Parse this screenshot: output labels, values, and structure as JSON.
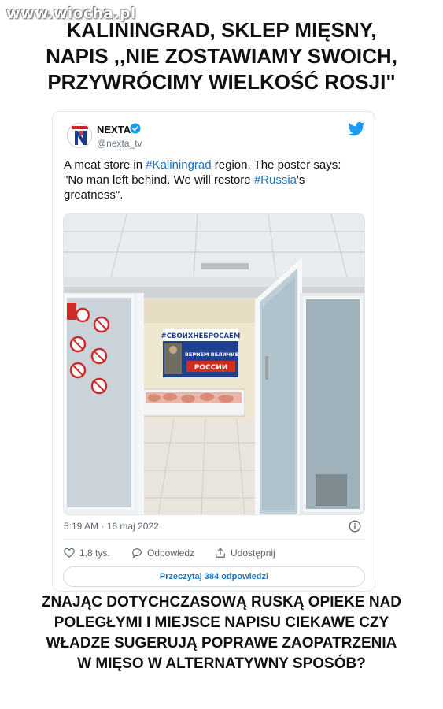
{
  "watermark": "www.wiocha.pl",
  "headline": [
    "KALININGRAD, SKLEP MIĘSNY,",
    "NAPIS ,,NIE ZOSTAWIAMY SWOICH,",
    "PRZYWRÓCIMY WIELKOŚĆ ROSJI\""
  ],
  "tweet": {
    "author_name": "NEXTA",
    "author_handle": "@nexta_tv",
    "text_parts": [
      "A meat store in ",
      "#Kaliningrad",
      " region. The poster says: \"No man left behind. We will restore ",
      "#Russia",
      "'s greatness\"."
    ],
    "timestamp": "5:19 AM · 16 maj 2022",
    "likes": "1,8 tys.",
    "reply_label": "Odpowiedz",
    "share_label": "Udostępnij",
    "read_replies": "Przeczytaj 384 odpowiedzi",
    "poster_text": {
      "hashtag": "#СВОИХНЕБРОСАЕМ",
      "line1": "ВЕРНЕМ ВЕЛИЧИЕ",
      "line2": "РОССИИ"
    }
  },
  "bottom_text": [
    "ZNAJĄC DOTYCHCZASOWĄ RUSKĄ  OPIEKE NAD",
    "POLEGŁYMI I MIEJSCE NAPISU CIEKAWE CZY",
    "WŁADZE SUGERUJĄ POPRAWE ZAOPATRZENIA",
    "W MIĘSO W ALTERNATYWNY SPOSÓB?"
  ],
  "icons": [
    "nexta-logo-icon",
    "verified-badge-icon",
    "twitter-bird-icon",
    "info-icon",
    "heart-icon",
    "reply-icon",
    "share-icon"
  ],
  "colors": {
    "link": "#1b76c1",
    "verified": "#1d9bf0",
    "twitter": "#1d9bf0",
    "muted": "#5b6672"
  }
}
